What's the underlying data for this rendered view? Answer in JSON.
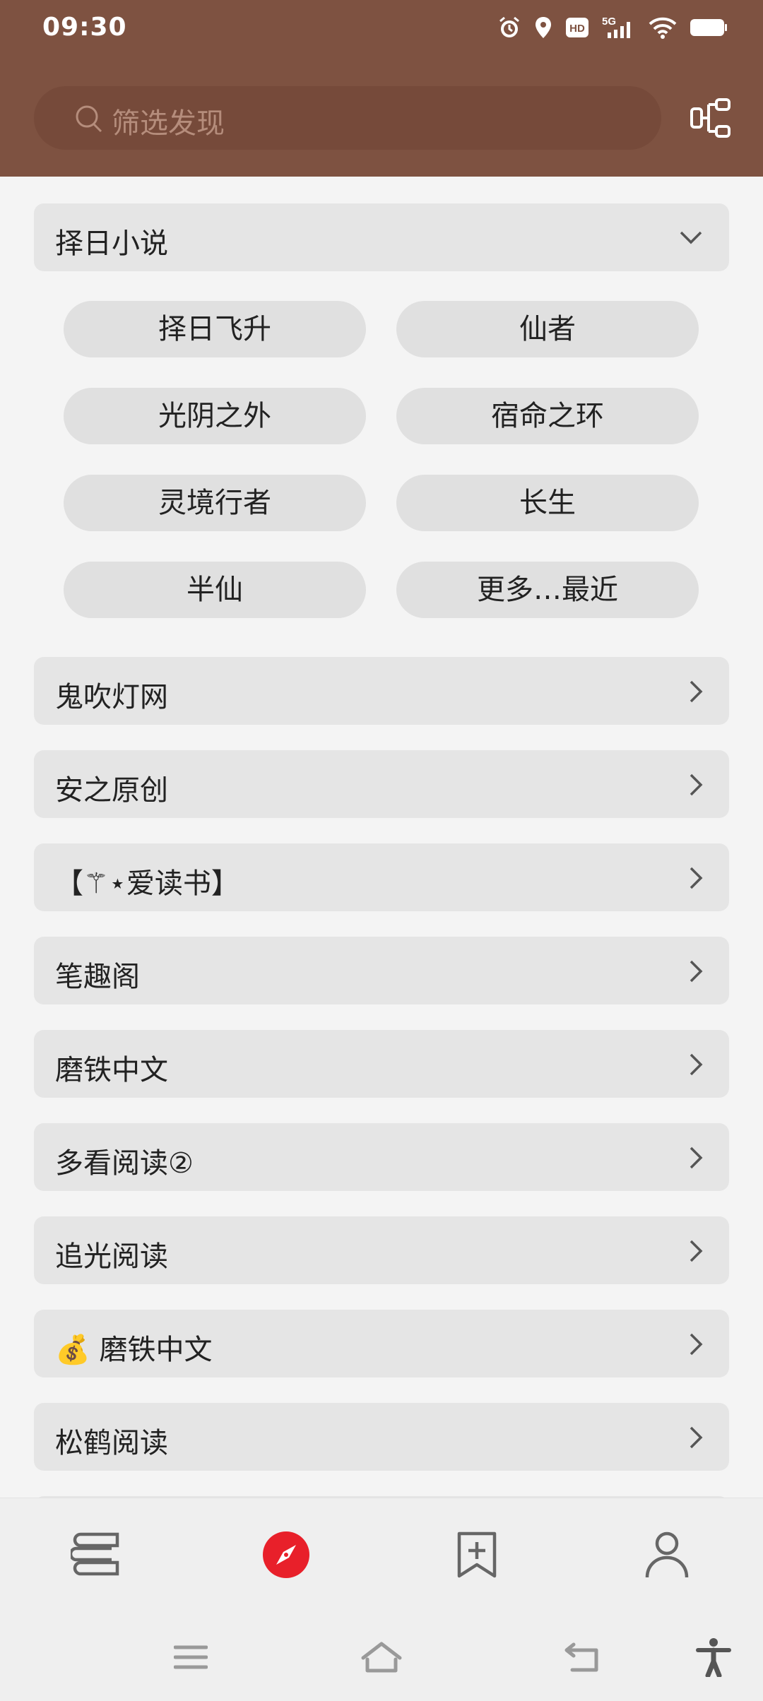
{
  "status": {
    "time": "09:30",
    "icons": [
      "alarm-icon",
      "location-icon",
      "hd-icon",
      "5g-signal-icon",
      "wifi-icon",
      "battery-icon"
    ],
    "network_label": "5G",
    "hd_label": "HD"
  },
  "search": {
    "placeholder": "筛选发现",
    "icon": "search-icon"
  },
  "header_action_icon": "share-tree-icon",
  "expanded_group": {
    "title": "择日小说",
    "chips": [
      "择日飞升",
      "仙者",
      "光阴之外",
      "宿命之环",
      "灵境行者",
      "长生",
      "半仙",
      "更多…最近"
    ]
  },
  "groups": [
    {
      "title": " 鬼吹灯网"
    },
    {
      "title": "安之原创"
    },
    {
      "title": "【⚚⋆爱读书】"
    },
    {
      "title": "笔趣阁"
    },
    {
      "title": "磨铁中文"
    },
    {
      "title": "多看阅读②"
    },
    {
      "title": "追光阅读"
    },
    {
      "title": "💰 磨铁中文"
    },
    {
      "title": "松鹤阅读"
    }
  ],
  "bottom_nav": [
    {
      "name": "bookshelf",
      "icon": "books-icon",
      "active": false
    },
    {
      "name": "discover",
      "icon": "compass-icon",
      "active": true
    },
    {
      "name": "subscribe",
      "icon": "bookmark-add-icon",
      "active": false
    },
    {
      "name": "profile",
      "icon": "person-icon",
      "active": false
    }
  ],
  "colors": {
    "header": "#7e5241",
    "accent": "#e8202a",
    "row_bg": "#e5e5e5",
    "chip_bg": "#e0e0e0"
  }
}
